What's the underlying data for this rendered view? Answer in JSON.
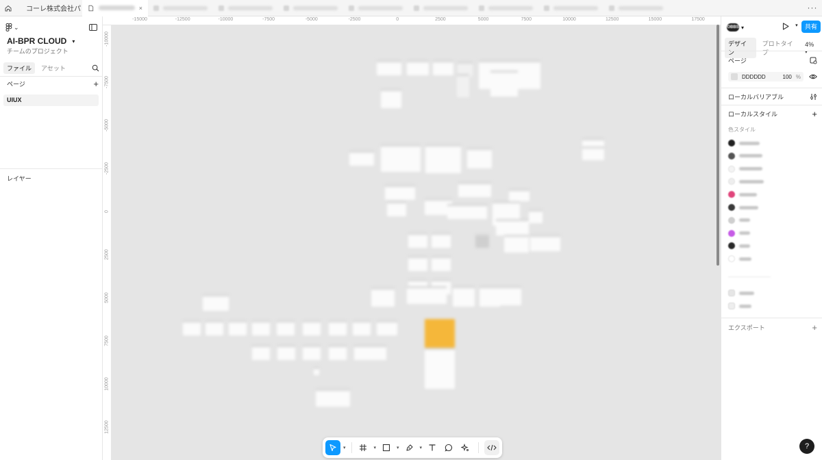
{
  "tabbar": {
    "first_tab": "コーレ株式会社パン",
    "active_tab": "",
    "more": "···"
  },
  "left_panel": {
    "project_title": "AI-BPR CLOUD",
    "project_subtitle": "チームのプロジェクト",
    "tabs": [
      "ファイル",
      "アセット"
    ],
    "pages_header": "ページ",
    "pages": [
      {
        "label": "UIUX"
      }
    ],
    "layers_header": "レイヤー"
  },
  "canvas": {
    "ruler_x": [
      "-15000",
      "-12500",
      "-10000",
      "-7500",
      "-5000",
      "-2500",
      "0",
      "2500",
      "5000",
      "7500",
      "10000",
      "12500",
      "15000",
      "17500"
    ],
    "ruler_y": [
      "-10000",
      "-7500",
      "-5000",
      "-2500",
      "0",
      "2500",
      "5000",
      "7500",
      "10000",
      "12500"
    ]
  },
  "toolbar": {
    "tools": [
      "move-tool",
      "frame-tool",
      "shape-tool",
      "pen-tool",
      "text-tool",
      "comment-tool",
      "actions-tool",
      "dev-mode-toggle"
    ]
  },
  "right_panel": {
    "avatar_text": "OBBS",
    "share_label": "共有",
    "tabs": [
      "デザイン",
      "プロトタイプ"
    ],
    "zoom": "4%",
    "page_header": "ページ",
    "page_bg_hex": "DDDDDD",
    "page_bg_opacity": "100",
    "percent_sign": "%",
    "local_variables": "ローカルバリアブル",
    "local_styles": "ローカルスタイル",
    "color_styles_header": "色スタイル",
    "color_swatches": [
      "#222222",
      "#555555",
      "#f4f4f4",
      "#eeeeee",
      "#e0457b",
      "#3a3a3a",
      "#cfcfcf",
      "#c65ce6",
      "#2a2a2a",
      "#ffffff"
    ],
    "effect_swatches": [
      "#e6e6e6",
      "#eeeeee"
    ],
    "export": "エクスポート"
  },
  "help": "?"
}
